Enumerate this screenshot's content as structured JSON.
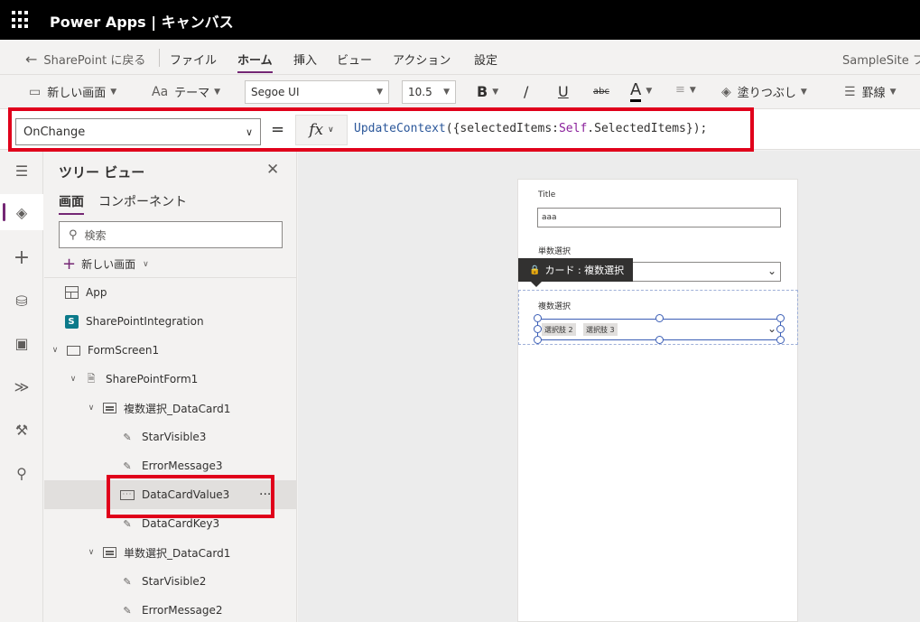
{
  "app": {
    "title": "Power Apps | キャンバス"
  },
  "menu": {
    "back_label": "SharePoint に戻る",
    "items": [
      "ファイル",
      "ホーム",
      "挿入",
      "ビュー",
      "アクション",
      "設定"
    ],
    "active": "ホーム",
    "site_name": "SampleSite フ"
  },
  "toolbar": {
    "new_screen": "新しい画面",
    "theme": "テーマ",
    "font_family": "Segoe UI",
    "font_size": "10.5",
    "bold": "B",
    "italic": "/",
    "underline": "U",
    "strike": "abc",
    "font_color": "A",
    "fill": "塗りつぶし",
    "border": "罫線"
  },
  "formula_bar": {
    "property": "OnChange",
    "equals": "=",
    "fx": "fx",
    "formula_fn": "UpdateContext",
    "formula_part1": "({selectedItems:",
    "formula_kw": "Self",
    "formula_part2": ".SelectedItems});"
  },
  "tree_view": {
    "title": "ツリー ビュー",
    "tabs": [
      "画面",
      "コンポーネント"
    ],
    "search_placeholder": "検索",
    "new_screen": "新しい画面",
    "nodes": [
      {
        "label": "App",
        "icon": "app-icon"
      },
      {
        "label": "SharePointIntegration",
        "icon": "sharepoint-icon"
      },
      {
        "label": "FormScreen1",
        "icon": "screen-icon"
      },
      {
        "label": "SharePointForm1",
        "icon": "form-icon"
      },
      {
        "label": "複数選択_DataCard1",
        "icon": "datacard-icon"
      },
      {
        "label": "StarVisible3",
        "icon": "label-edit-icon"
      },
      {
        "label": "ErrorMessage3",
        "icon": "label-edit-icon"
      },
      {
        "label": "DataCardValue3",
        "icon": "combobox-icon",
        "more": "···"
      },
      {
        "label": "DataCardKey3",
        "icon": "label-edit-icon"
      },
      {
        "label": "単数選択_DataCard1",
        "icon": "datacard-icon"
      },
      {
        "label": "StarVisible2",
        "icon": "label-edit-icon"
      },
      {
        "label": "ErrorMessage2",
        "icon": "label-edit-icon"
      }
    ]
  },
  "form": {
    "title_label": "Title",
    "title_value": "aaa",
    "single_label": "単数選択",
    "multi_label": "複数選択",
    "chips": [
      "選択肢 2",
      "選択肢 3"
    ],
    "tooltip": "カード : 複数選択"
  },
  "colors": {
    "accent": "#742774",
    "highlight": "#e0001b",
    "selection": "#3b5eb6"
  }
}
